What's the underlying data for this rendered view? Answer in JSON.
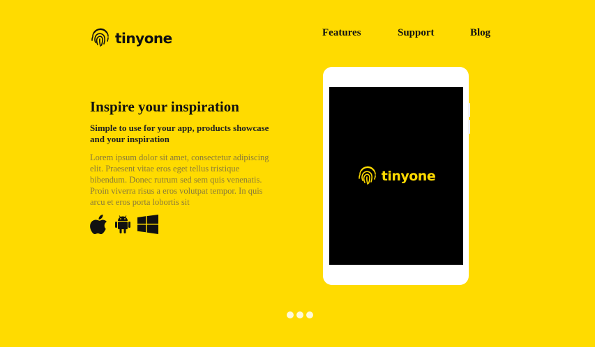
{
  "brand": {
    "name": "tinyone",
    "icon": "fingerprint-icon"
  },
  "nav": {
    "items": [
      "Features",
      "Support",
      "Blog"
    ]
  },
  "hero": {
    "title": "Inspire your inspiration",
    "subtitle": "Simple to use for your app, products showcase and your inspiration",
    "body": "Lorem ipsum dolor sit amet, consectetur adipiscing elit. Praesent vitae eros eget tellus tristique bibendum. Donec rutrum sed sem quis venenatis. Proin viverra risus a eros volutpat tempor. In quis arcu et eros porta lobortis sit",
    "platforms": [
      "apple-icon",
      "android-icon",
      "windows-icon"
    ]
  },
  "device": {
    "screen_brand": "tinyone"
  },
  "carousel": {
    "dot_count": 3,
    "active_index": 0
  },
  "colors": {
    "background": "#FFDB00",
    "text": "#111111",
    "muted_text": "#8A7A3A",
    "screen": "#000000",
    "device_frame": "#FFFFFF"
  }
}
